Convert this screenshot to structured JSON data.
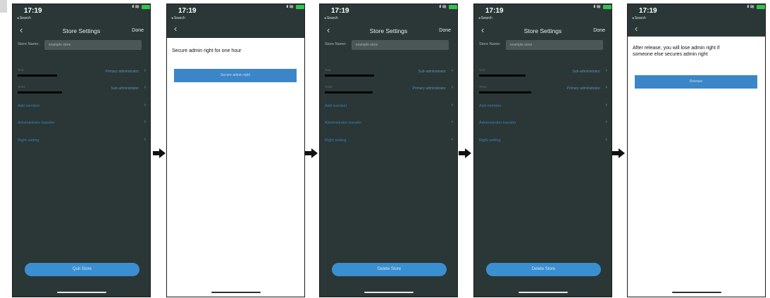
{
  "status": {
    "time": "17:19",
    "back_label": "◂ Search",
    "signal": "ııl",
    "wifi": "≋"
  },
  "settings": {
    "title": "Store Settings",
    "done": "Done",
    "store_name_label": "Store Name:",
    "store_name_value": "example store",
    "add_member": "Add member",
    "admin_transfer": "Administrator transfer",
    "right_setting": "Right setting"
  },
  "screens": [
    {
      "members": [
        {
          "label": "Test",
          "role": "Primary administrator"
        },
        {
          "label": "Test2",
          "role": "Sub-administrator"
        }
      ],
      "bottom_button": "Quit Store"
    },
    {
      "prompt": "Secure admin right for one hour",
      "button": "Secure admin right"
    },
    {
      "members": [
        {
          "label": "Test",
          "role": "Sub-administrator"
        },
        {
          "label": "Test2",
          "role": "Primary administrator"
        }
      ],
      "bottom_button": "Delete Store"
    },
    {
      "members": [
        {
          "label": "Test",
          "role": "Sub-administrator"
        },
        {
          "label": "Test2",
          "role": "Primary administrator"
        }
      ],
      "bottom_button": "Delete Store"
    },
    {
      "prompt_line1": "After release, you will lose admin right if",
      "prompt_line2": "someone else secures admin right",
      "button": "Release"
    }
  ],
  "icons": {
    "back": "chevron-left-icon",
    "row_arrow": "chevron-right-icon",
    "flow": "arrow-right-icon"
  },
  "colors": {
    "screen_bg": "#2a3736",
    "accent_button": "#3a8fd1",
    "link_text": "#3d7fb5",
    "battery": "#33c24d"
  }
}
